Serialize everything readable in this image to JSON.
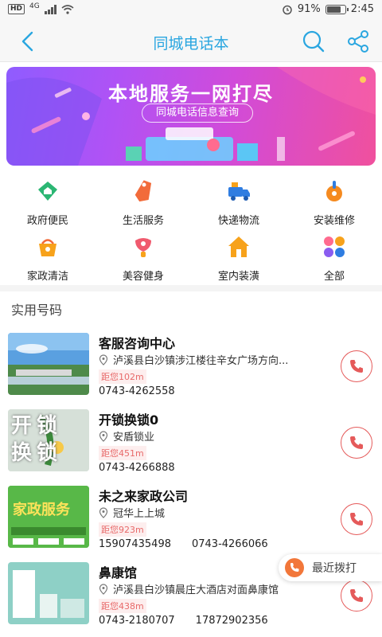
{
  "status_bar": {
    "hd": "HD",
    "network": "4G",
    "battery_percent": "91%",
    "time": "2:45"
  },
  "nav": {
    "title": "同城电话本"
  },
  "banner": {
    "title": "本地服务一网打尽",
    "subtitle": "同城电话信息查询"
  },
  "categories": [
    {
      "label": "政府便民",
      "icon": "government-icon",
      "color": "#2bb673"
    },
    {
      "label": "生活服务",
      "icon": "tag-icon",
      "color": "#f26b3a"
    },
    {
      "label": "快递物流",
      "icon": "delivery-truck-icon",
      "color": "#2f7de1"
    },
    {
      "label": "安装维修",
      "icon": "tools-icon",
      "color": "#f58a1f"
    },
    {
      "label": "家政清洁",
      "icon": "cleaning-bucket-icon",
      "color": "#f7a21b"
    },
    {
      "label": "美容健身",
      "icon": "beauty-icon",
      "color": "#f05a6e"
    },
    {
      "label": "室内装潢",
      "icon": "house-icon",
      "color": "#f7a21b"
    },
    {
      "label": "全部",
      "icon": "all-categories-icon",
      "color": "#8a5cf0"
    }
  ],
  "section": {
    "title": "实用号码"
  },
  "listings": [
    {
      "name": "客服咨询中心",
      "address": "泸溪县白沙镇涉江楼往辛女广场方向...",
      "distance": "距您102m",
      "phones": [
        "0743-4262558"
      ],
      "thumb_text": ""
    },
    {
      "name": "开锁换锁0",
      "address": "安盾锁业",
      "distance": "距您451m",
      "phones": [
        "0743-4266888"
      ],
      "thumb_text": "开锁换锁"
    },
    {
      "name": "未之来家政公司",
      "address": "冠华上上城",
      "distance": "距您923m",
      "phones": [
        "15907435498",
        "0743-4266066"
      ],
      "thumb_text": "家政服务"
    },
    {
      "name": "鼻康馆",
      "address": "泸溪县白沙镇晨庄大酒店对面鼻康馆",
      "distance": "距您438m",
      "phones": [
        "0743-2180707",
        "17872902356"
      ],
      "thumb_text": ""
    }
  ],
  "floating": {
    "recent_calls": "最近拨打"
  }
}
